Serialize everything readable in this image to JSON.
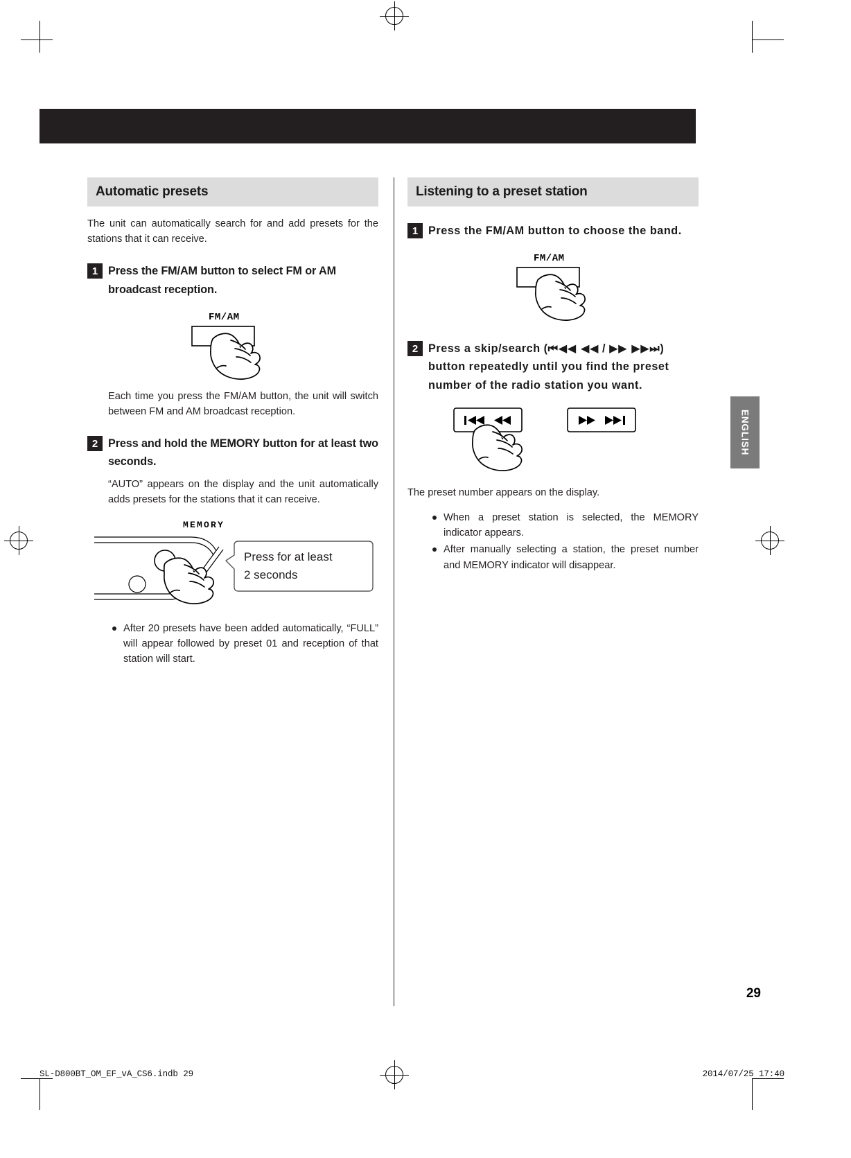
{
  "page": {
    "number": "29",
    "language_tab": "ENGLISH",
    "footer_left": "SL-D800BT_OM_EF_vA_CS6.indb   29",
    "footer_right": "2014/07/25   17:40"
  },
  "left_column": {
    "heading": "Automatic presets",
    "intro": "The unit can automatically search for and add presets for the stations that it can receive.",
    "step1": {
      "num": "1",
      "text": "Press the FM/AM button to select FM or AM broadcast reception.",
      "button_label": "FM/AM",
      "note": "Each time you press the FM/AM button, the unit will switch between FM and AM broadcast reception."
    },
    "step2": {
      "num": "2",
      "text": "Press and hold the MEMORY button for at least two seconds.",
      "note": "“AUTO” appears on the display and the unit automatically adds presets for the stations that it can receive.",
      "button_label": "MEMORY",
      "callout": "Press for at least 2 seconds",
      "callout_line1": "Press for at least",
      "callout_line2": "2 seconds"
    },
    "bullets": [
      "After 20 presets have been added automatically, “FULL” will appear followed by preset 01 and reception of that station will start."
    ]
  },
  "right_column": {
    "heading": "Listening to a preset station",
    "step1": {
      "num": "1",
      "text": "Press the FM/AM button to choose the band.",
      "button_label": "FM/AM"
    },
    "step2": {
      "num": "2",
      "text_part1": "Press a skip/search (",
      "symbols_left": "⏮◀◀ ◀◀",
      "text_slash": " / ",
      "symbols_right": "▶▶ ▶▶⏭",
      "text_part2": ") button repeatedly until you find the preset number of the radio station you want.",
      "button_left_label": "⏮◀◀  ◀◀",
      "button_right_label": "▶▶  ▶▶⏭",
      "note": "The preset number appears on the display."
    },
    "bullets": [
      "When a preset station is selected, the MEMORY indicator appears.",
      "After manually selecting a station, the preset number and MEMORY indicator will disappear."
    ]
  },
  "colors": {
    "header_bg": "#dcdcdc",
    "bar": "#231f20",
    "tab_bg": "#7b7b7b",
    "text": "#231f20"
  }
}
